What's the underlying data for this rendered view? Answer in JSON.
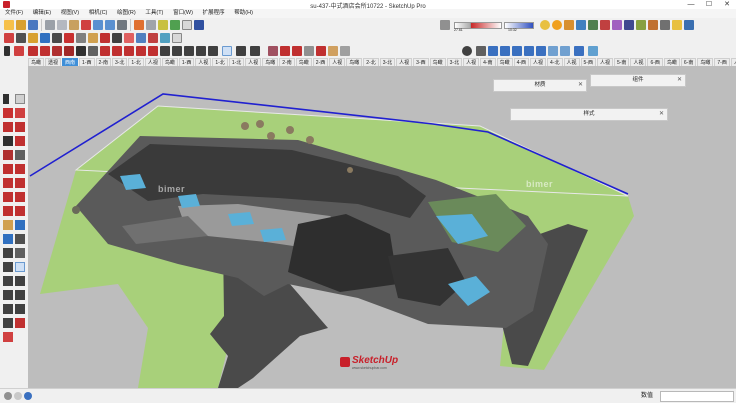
{
  "window": {
    "title": "su-437-中式酒店会所10722 - SketchUp Pro",
    "minimize_glyph": "—",
    "maximize_glyph": "☐",
    "close_glyph": "✕"
  },
  "menu": {
    "items": [
      "文件(F)",
      "编辑(E)",
      "视图(V)",
      "相机(C)",
      "绘图(R)",
      "工具(T)",
      "窗口(W)",
      "扩展程序",
      "帮助(H)"
    ]
  },
  "scenes": {
    "tabs": [
      "鸟瞰",
      "透视",
      "西南",
      "1-西",
      "2-南",
      "3-北",
      "1-北",
      "人视",
      "鸟瞰",
      "1-西",
      "人视",
      "1-北",
      "1-北",
      "人视",
      "鸟瞰",
      "2-南",
      "鸟瞰",
      "2-西",
      "人视",
      "鸟瞰",
      "2-北",
      "3-北",
      "人视",
      "3-西",
      "鸟瞰",
      "3-北",
      "人视",
      "4-南",
      "鸟瞰",
      "4-西",
      "人视",
      "4-北",
      "人视",
      "5-西",
      "人视",
      "5-南",
      "人视",
      "6-西",
      "鸟瞰",
      "6-南",
      "鸟瞰",
      "7-西",
      "人视",
      "7-北",
      "人视",
      "8-北",
      "人视",
      "8-南",
      "人视"
    ],
    "active_index": 2
  },
  "panels": {
    "materials": {
      "title": "材质",
      "close": "✕"
    },
    "components": {
      "title": "组件",
      "close": "✕"
    },
    "styles": {
      "title": "样式",
      "close": "✕"
    }
  },
  "status": {
    "measurements_label": "数值",
    "measurements_value": ""
  },
  "watermarks": {
    "logo_text": "SketchUp",
    "logo_subtext": "www.sketchupbar.com",
    "bimer_text": "bimer"
  },
  "toolbar": {
    "gradient_min": "27.61",
    "gradient_max": "10:32"
  },
  "colors": {
    "accent_tab": "#3f8fd8",
    "sketchup_red": "#c8202a",
    "site_green": "#a8d07a",
    "boundary_blue": "#2020d0"
  }
}
